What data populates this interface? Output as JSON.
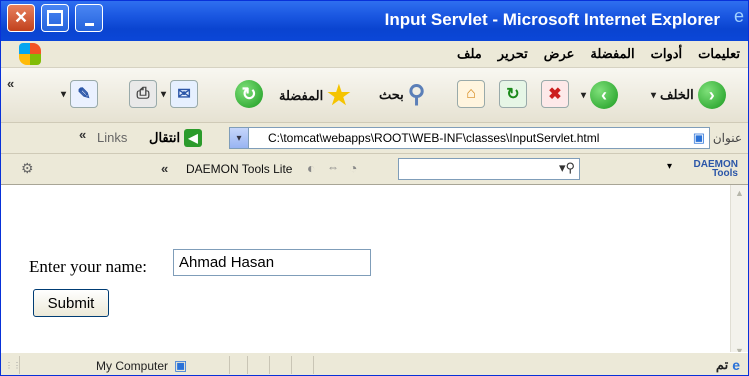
{
  "window": {
    "title": "Input Servlet - Microsoft Internet Explorer"
  },
  "menu": [
    "ملف",
    "تحرير",
    "عرض",
    "المفضلة",
    "أدوات",
    "تعليمات"
  ],
  "toolbar": {
    "back_label": "الخلف",
    "search_label": "بحث",
    "favorites_label": "المفضلة"
  },
  "address": {
    "label": "عنوان",
    "url": "C:\\tomcat\\webapps\\ROOT\\WEB-INF\\classes\\InputServlet.html",
    "go_label": "انتقال",
    "links_label": "Links"
  },
  "daemon": {
    "label": "DAEMON Tools Lite",
    "logo_line1": "DAEMON",
    "logo_line2": "Tools"
  },
  "form": {
    "name_label": "Enter your name:",
    "name_value": "Ahmad Hasan",
    "submit_label": "Submit"
  },
  "status": {
    "zone": "My Computer",
    "done": "تم"
  }
}
